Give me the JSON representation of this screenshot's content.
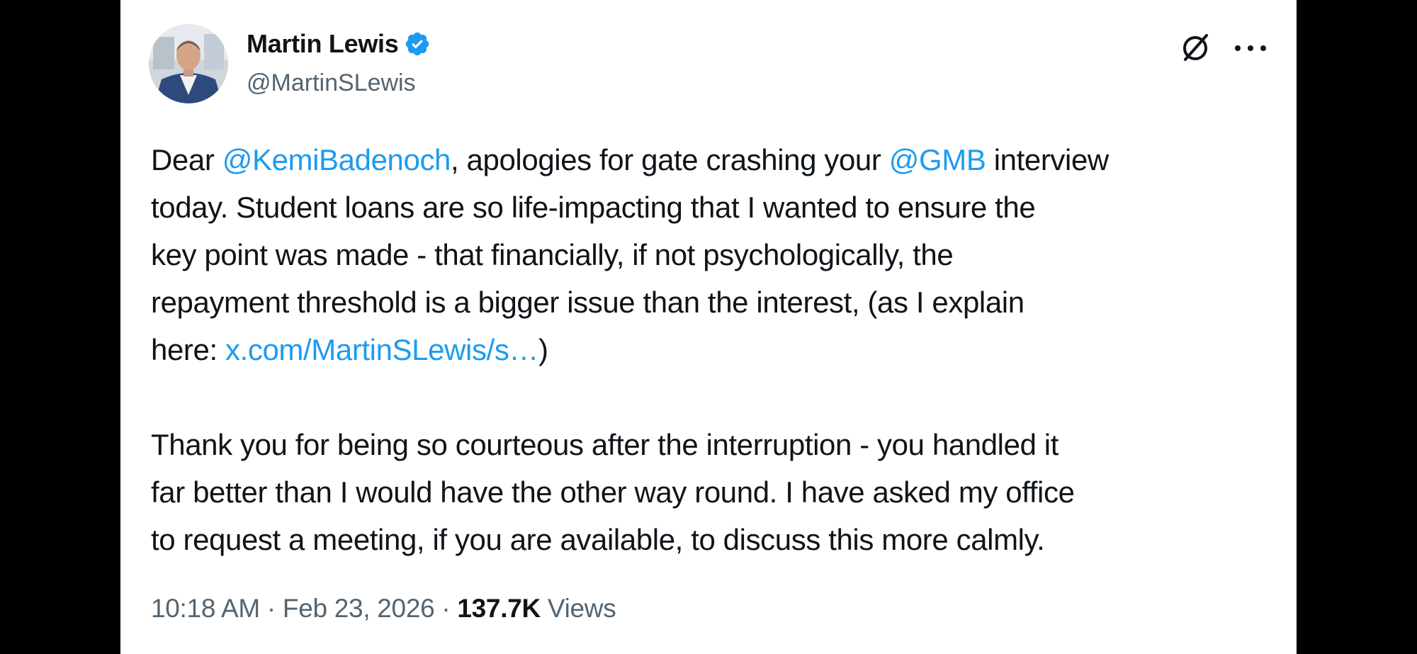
{
  "author": {
    "display_name": "Martin Lewis",
    "handle": "@MartinSLewis",
    "verified": true,
    "verified_badge_icon": "verified-badge-icon",
    "verified_color": "#1d9bf0"
  },
  "actions": {
    "grok_icon": "grok-icon",
    "more_icon": "more-options-icon"
  },
  "tweet": {
    "line1": {
      "text_a": "Dear ",
      "mention_a": "@KemiBadenoch",
      "text_b": ", apologies for gate crashing your ",
      "mention_b": "@GMB",
      "text_c": " interview"
    },
    "line2": "today. Student loans are so life-impacting that I wanted to ensure the",
    "line3": "key point was made - that financially, if not psychologically, the",
    "line4": "repayment threshold is a bigger issue than the interest, (as I explain",
    "line5": {
      "text_a": "here: ",
      "link": "x.com/MartinSLewis/s…",
      "text_b": ")"
    },
    "line6": "Thank you for being so courteous after the interruption - you handled it",
    "line7": "far better than I would have the other way round. I have asked my office",
    "line8": "to request a meeting, if you are available, to discuss this more calmly."
  },
  "meta": {
    "time": "10:18 AM",
    "separator": " · ",
    "date": "Feb 23, 2026",
    "views_count": "137.7K",
    "views_label": " Views"
  },
  "colors": {
    "text_primary": "#0f1419",
    "text_secondary": "#536471",
    "accent": "#1d9bf0",
    "background": "#ffffff",
    "frame": "#000000"
  }
}
